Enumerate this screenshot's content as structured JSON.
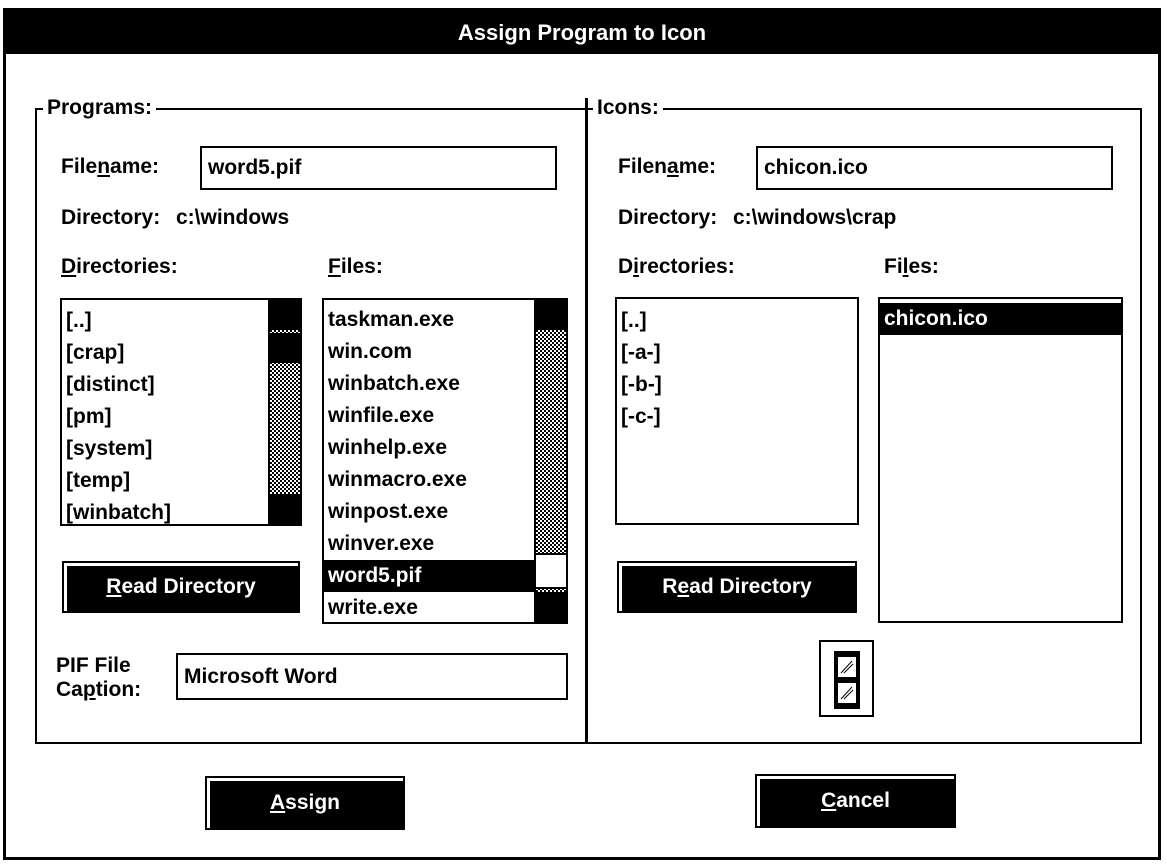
{
  "window": {
    "title": "Assign Program to Icon"
  },
  "programs": {
    "group_label": "Programs:",
    "filename_label_pre": "File",
    "filename_label_u": "n",
    "filename_label_post": "ame:",
    "filename_value": "word5.pif",
    "directory_label": "Directory:",
    "directory_value": "c:\\windows",
    "directories_label_u": "D",
    "directories_label_post": "irectories:",
    "files_label_u": "F",
    "files_label_post": "iles:",
    "directories": [
      "[..]",
      "[crap]",
      "[distinct]",
      "[pm]",
      "[system]",
      "[temp]",
      "[winbatch]"
    ],
    "files": [
      "taskman.exe",
      "win.com",
      "winbatch.exe",
      "winfile.exe",
      "winhelp.exe",
      "winmacro.exe",
      "winpost.exe",
      "winver.exe",
      "word5.pif",
      "write.exe"
    ],
    "selected_file": "word5.pif",
    "read_dir_u": "R",
    "read_dir_post": "ead Directory",
    "pif_label_line1": "PIF File",
    "pif_label_line2_pre": "Ca",
    "pif_label_line2_u": "p",
    "pif_label_line2_post": "tion:",
    "pif_caption_value": "Microsoft Word"
  },
  "icons": {
    "group_label": "Icons:",
    "filename_label_pre": "Filen",
    "filename_label_u": "a",
    "filename_label_post": "me:",
    "filename_value": "chicon.ico",
    "directory_label": "Directory:",
    "directory_value": "c:\\windows\\crap",
    "directories_label_pre": "D",
    "directories_label_u": "i",
    "directories_label_post": "rectories:",
    "files_label_pre": "Fi",
    "files_label_u": "l",
    "files_label_post": "es:",
    "directories": [
      "[..]",
      "[-a-]",
      "[-b-]",
      "[-c-]"
    ],
    "files": [
      "chicon.ico"
    ],
    "selected_file": "chicon.ico",
    "read_dir_pre": "R",
    "read_dir_u": "e",
    "read_dir_post": "ad Directory",
    "preview_icon": "window-icon"
  },
  "buttons": {
    "assign_u": "A",
    "assign_post": "ssign",
    "cancel_u": "C",
    "cancel_post": "ancel"
  }
}
